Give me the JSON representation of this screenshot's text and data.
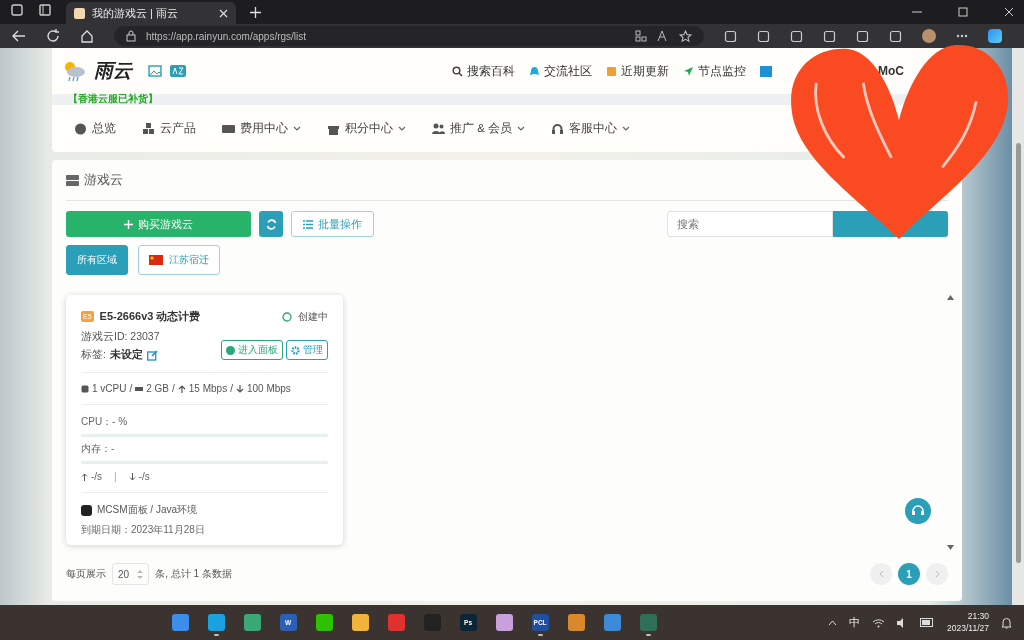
{
  "browser": {
    "tab_title": "我的游戏云 | 雨云",
    "url": "https://app.rainyun.com/apps/rgs/list"
  },
  "site": {
    "logo": "雨云",
    "top_links": [
      {
        "label": "搜索百科",
        "kind": "search"
      },
      {
        "label": "交流社区",
        "kind": "chat"
      },
      {
        "label": "近期更新",
        "kind": "book"
      },
      {
        "label": "节点监控",
        "kind": "arrow"
      }
    ],
    "user": "MoC",
    "notice": "【香港云服已补货】",
    "nav": [
      {
        "label": "总览",
        "kind": "gauge",
        "dropdown": false
      },
      {
        "label": "云产品",
        "kind": "cubes",
        "dropdown": false
      },
      {
        "label": "费用中心",
        "kind": "money",
        "dropdown": true
      },
      {
        "label": "积分中心",
        "kind": "gift",
        "dropdown": true
      },
      {
        "label": "推广 & 会员",
        "kind": "users",
        "dropdown": true
      },
      {
        "label": "客服中心",
        "kind": "headset",
        "dropdown": true
      }
    ]
  },
  "panel": {
    "title": "游戏云",
    "buy_button": "购买游戏云",
    "batch_button": "批量操作",
    "search": {
      "placeholder": "搜索"
    },
    "regions": [
      {
        "label": "所有区域",
        "selected": true,
        "flag": false
      },
      {
        "label": "江苏宿迁",
        "selected": false,
        "flag": true
      }
    ],
    "card": {
      "badge": "E5",
      "name": "E5-2666v3 动态计费",
      "status": "创建中",
      "id_line": "游戏云ID: 23037",
      "tag_label": "标签:",
      "tag_value": "未设定",
      "panel_button": "进入面板",
      "manage_button": "管理",
      "specs": [
        {
          "kind": "chip",
          "text": "1 vCPU"
        },
        {
          "kind": "memory",
          "text": "2 GB"
        },
        {
          "kind": "up",
          "text": "15 Mbps"
        },
        {
          "kind": "down",
          "text": "100 Mbps"
        }
      ],
      "spec_separator": "/",
      "meters": [
        {
          "label": "CPU：- %",
          "level": 0
        },
        {
          "label": "内存：-",
          "level": 0
        }
      ],
      "upload": "-/s",
      "download": "-/s",
      "traffic_separator": "|",
      "environment": "MCSM面板 / Java环境",
      "expiry": "到期日期：2023年11月28日"
    },
    "pagination": {
      "per_page_label": "每页展示",
      "per_page": "20",
      "total": "条, 总计 1 条数据",
      "pages": [
        {
          "label": "1",
          "selected": true
        }
      ]
    }
  },
  "taskbar": {
    "apps": [
      {
        "kind": "start",
        "running": false
      },
      {
        "kind": "edge",
        "running": true
      },
      {
        "kind": "browser",
        "running": false
      },
      {
        "kind": "word",
        "label": "W",
        "running": false
      },
      {
        "kind": "wechat",
        "running": false
      },
      {
        "kind": "folder",
        "running": false
      },
      {
        "kind": "music",
        "running": false
      },
      {
        "kind": "penguin",
        "running": false
      },
      {
        "kind": "photoshop",
        "label": "Ps",
        "running": false
      },
      {
        "kind": "dots",
        "running": false
      },
      {
        "kind": "pcl",
        "label": "PCL",
        "running": true
      },
      {
        "kind": "chicken",
        "running": false
      },
      {
        "kind": "window",
        "running": false
      },
      {
        "kind": "owl",
        "running": true
      }
    ],
    "ime": "中",
    "time": "21:30",
    "date": "2023/11/27"
  }
}
